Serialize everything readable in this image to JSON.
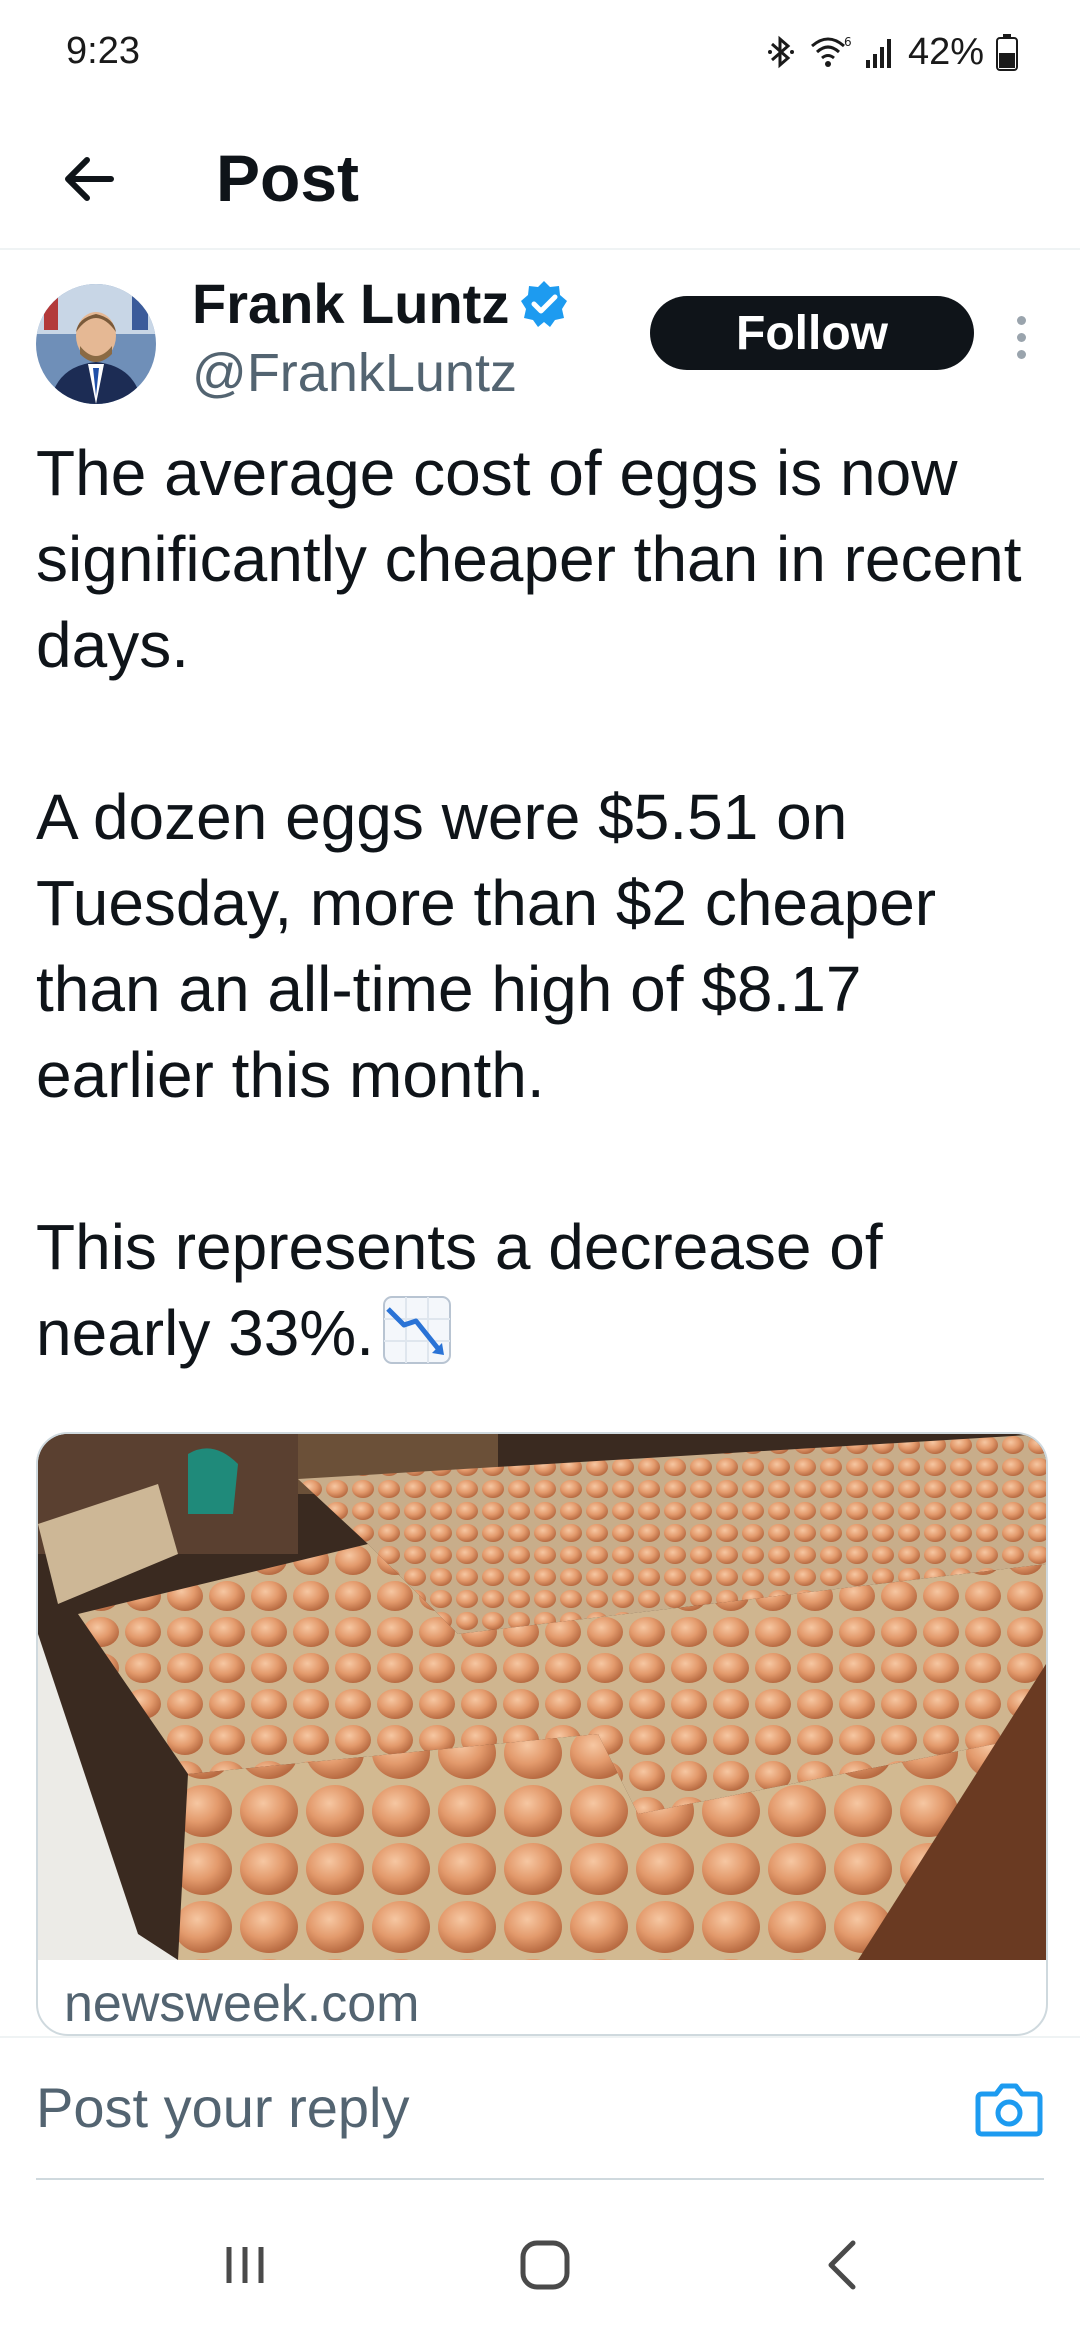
{
  "status_bar": {
    "time": "9:23",
    "battery": "42%",
    "icons": [
      "bluetooth-icon",
      "wifi-icon",
      "signal-icon",
      "battery-icon"
    ]
  },
  "header": {
    "title": "Post",
    "back_icon": "arrow-left-icon"
  },
  "post": {
    "author": {
      "name": "Frank Luntz",
      "handle": "@FrankLuntz",
      "verified": true
    },
    "follow_label": "Follow",
    "paragraphs": [
      "The average cost of eggs is now significantly cheaper than in recent days.",
      "A dozen eggs were $5.51 on Tuesday, more than $2 cheaper than an all-time high of $8.17 earlier this month.",
      "This represents a decrease of nearly 33%."
    ],
    "emoji": "chart-decreasing-emoji",
    "link_card": {
      "domain": "newsweek.com"
    }
  },
  "reply": {
    "placeholder": "Post your reply"
  },
  "nav": {
    "icons": [
      "recent-apps-icon",
      "home-icon",
      "back-icon"
    ]
  },
  "colors": {
    "verified": "#1d9bf0",
    "follow_bg": "#0f1419",
    "muted_text": "#536471",
    "camera": "#1d9bf0"
  }
}
